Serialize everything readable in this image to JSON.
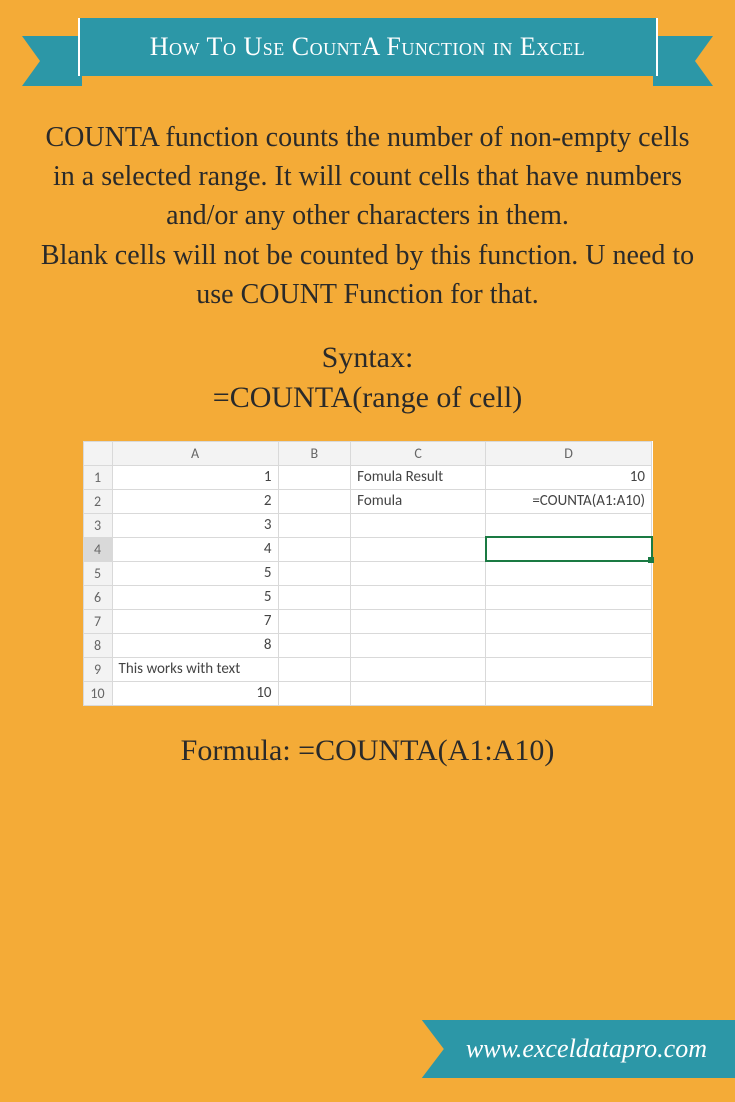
{
  "header": {
    "title": "How To Use CountA Function in Excel"
  },
  "body": {
    "para1": "COUNTA function counts the number of non-empty cells in a selected range. It will count cells that have numbers and/or any other characters in them.",
    "para2": "Blank cells will not be counted by this function. U need to use COUNT Function for that.",
    "syntax_label": "Syntax:",
    "syntax_value": "=COUNTA(range of cell)",
    "formula_label": "Formula: =COUNTA(A1:A10)"
  },
  "excel": {
    "columns": [
      "A",
      "B",
      "C",
      "D"
    ],
    "rows": [
      "1",
      "2",
      "3",
      "4",
      "5",
      "6",
      "7",
      "8",
      "9",
      "10"
    ],
    "active_row": "4",
    "cells": {
      "A1": "1",
      "A2": "2",
      "A3": "3",
      "A4": "4",
      "A5": "5",
      "A6": "5",
      "A7": "7",
      "A8": "8",
      "A9": "This works with text",
      "A10": "10",
      "C1": "Fomula Result",
      "C2": "Fomula",
      "D1": "10",
      "D2": "=COUNTA(A1:A10)"
    }
  },
  "footer": {
    "url": "www.exceldatapro.com"
  }
}
